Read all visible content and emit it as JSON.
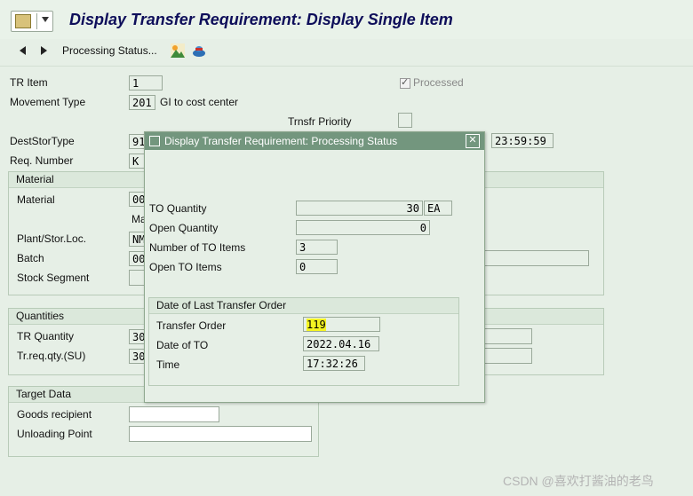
{
  "title": "Display Transfer Requirement: Display Single Item",
  "toolbar": {
    "processing_status_label": "Processing Status...",
    "icons": [
      "navigate-previous-icon",
      "navigate-next-icon",
      "landscape-icon",
      "transport-icon"
    ]
  },
  "header": {
    "tr_item": {
      "label": "TR Item",
      "value": "1"
    },
    "processed": {
      "label": "Processed",
      "checked": true
    },
    "movement_type": {
      "label": "Movement Type",
      "code": "201",
      "text": "GI to cost center"
    },
    "trnsfr_priority": {
      "label": "Trnsfr Priority"
    },
    "dest_stor_type": {
      "label": "DestStorType",
      "value": "91"
    },
    "time_value": "23:59:59",
    "req_number": {
      "label": "Req. Number",
      "value": "K"
    }
  },
  "material_group": {
    "title": "Material",
    "material": {
      "label": "Material",
      "value": "00"
    },
    "ma_partial": "Ma",
    "plant_stor_loc": {
      "label": "Plant/Stor.Loc.",
      "value": "NM"
    },
    "batch": {
      "label": "Batch",
      "value": "00"
    },
    "stock_segment": {
      "label": "Stock Segment",
      "value": ""
    }
  },
  "quantities_group": {
    "title": "Quantities",
    "tr_quantity": {
      "label": "TR Quantity",
      "value": "30"
    },
    "tr_req_qty_su": {
      "label": "Tr.req.qty.(SU)",
      "value": "30"
    }
  },
  "target_group": {
    "title": "Target Data",
    "goods_recipient": {
      "label": "Goods recipient",
      "value": ""
    },
    "unloading_point": {
      "label": "Unloading Point",
      "value": ""
    }
  },
  "dialog": {
    "title": "Display Transfer Requirement: Processing Status",
    "to_quantity": {
      "label": "TO Quantity",
      "value": "30",
      "unit": "EA"
    },
    "open_quantity": {
      "label": "Open Quantity",
      "value": "0"
    },
    "number_of_to_items": {
      "label": "Number of TO Items",
      "value": "3"
    },
    "open_to_items": {
      "label": "Open TO Items",
      "value": "0"
    },
    "last_to_group": {
      "title": "Date of Last Transfer Order",
      "transfer_order": {
        "label": "Transfer Order",
        "value": "119"
      },
      "date_of_to": {
        "label": "Date of TO",
        "value": "2022.04.16"
      },
      "time": {
        "label": "Time",
        "value": "17:32:26"
      }
    }
  },
  "watermark": "CSDN @喜欢打酱油的老鸟",
  "colors": {
    "background": "#e6efe6",
    "title_text": "#0e0e5a",
    "dialog_titlebar": "#73967e",
    "highlight": "#f5f521"
  }
}
